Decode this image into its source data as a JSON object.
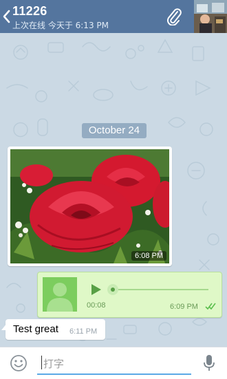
{
  "header": {
    "title": "11226",
    "subtitle": "上次在线 今天于 6:13 PM",
    "bg_color": "#54759e"
  },
  "chat": {
    "date_label": "October 24",
    "messages": [
      {
        "type": "photo",
        "direction": "incoming",
        "time": "6:08 PM",
        "content_icon": "red-roses-photo"
      },
      {
        "type": "voice",
        "direction": "outgoing",
        "duration": "00:08",
        "time": "6:09 PM",
        "status": "read",
        "status_icon": "double-check-icon"
      },
      {
        "type": "text",
        "direction": "incoming",
        "text": "Test great",
        "time": "6:11 PM"
      }
    ]
  },
  "composer": {
    "placeholder": "打字",
    "emoji_icon": "smiley-icon",
    "mic_icon": "microphone-icon"
  },
  "colors": {
    "outgoing_bubble": "#dff8c7",
    "incoming_bubble": "#ffffff",
    "accent": "#5aa9e6",
    "read_check": "#5cbf4e"
  }
}
